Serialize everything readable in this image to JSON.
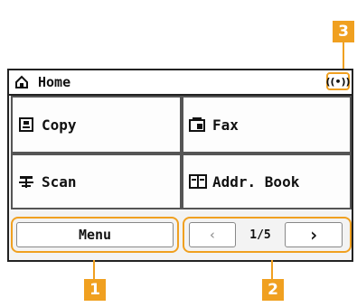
{
  "screen": {
    "title": "Home",
    "tiles": [
      {
        "label": "Copy",
        "icon": "copy-icon"
      },
      {
        "label": "Fax",
        "icon": "fax-icon"
      },
      {
        "label": "Scan",
        "icon": "scan-icon"
      },
      {
        "label": "Addr. Book",
        "icon": "address-book-icon"
      }
    ],
    "menu_label": "Menu",
    "page_indicator": "1/5",
    "prev_glyph": "‹",
    "next_glyph": "›",
    "wireless_glyph": "((•))"
  },
  "callouts": [
    "1",
    "2",
    "3"
  ],
  "colors": {
    "accent": "#f0a020",
    "frame": "#222222"
  }
}
